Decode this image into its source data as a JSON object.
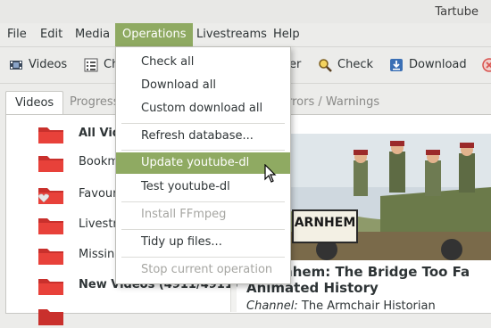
{
  "window": {
    "title": "Tartube"
  },
  "menubar": {
    "items": [
      {
        "id": "file",
        "label": "File"
      },
      {
        "id": "edit",
        "label": "Edit"
      },
      {
        "id": "media",
        "label": "Media"
      },
      {
        "id": "operations",
        "label": "Operations"
      },
      {
        "id": "livestreams",
        "label": "Livestreams"
      },
      {
        "id": "help",
        "label": "Help"
      }
    ]
  },
  "toolbar": {
    "videos_label": "Videos",
    "ch_label": "Ch",
    "er_label": "er",
    "check_label": "Check",
    "download_label": "Download"
  },
  "tabs": {
    "videos": "Videos",
    "progress": "Progress",
    "errors": "rrors / Warnings"
  },
  "tree": {
    "items": [
      {
        "label": "All Vid",
        "bold": true
      },
      {
        "label": "Bookm",
        "bold": false
      },
      {
        "label": "Favour",
        "bold": false
      },
      {
        "label": "Livestr",
        "bold": false
      },
      {
        "label": "Missing",
        "bold": false
      },
      {
        "label": "New Videos (4911/4911)",
        "bold": true
      }
    ]
  },
  "dropdown": {
    "items": [
      {
        "label": "Check all",
        "state": "normal"
      },
      {
        "label": "Download all",
        "state": "normal"
      },
      {
        "label": "Custom download all",
        "state": "normal"
      },
      {
        "label": "Refresh database...",
        "state": "normal"
      },
      {
        "label": "Update youtube-dl",
        "state": "highlight"
      },
      {
        "label": "Test youtube-dl",
        "state": "normal"
      },
      {
        "label": "Install FFmpeg",
        "state": "disabled"
      },
      {
        "label": "Tidy up files...",
        "state": "normal"
      },
      {
        "label": "Stop current operation",
        "state": "disabled"
      }
    ]
  },
  "video": {
    "thumbnail_text": "ARNHEM",
    "title_line1": "of Arnhem: The Bridge Too Fa",
    "title_line2": "Animated History",
    "channel_label": "Channel:",
    "channel_value": "The Armchair Historian"
  },
  "colors": {
    "accent": "#8faa62",
    "folder_red": "#e8413a",
    "download_blue": "#3a6fb5"
  }
}
